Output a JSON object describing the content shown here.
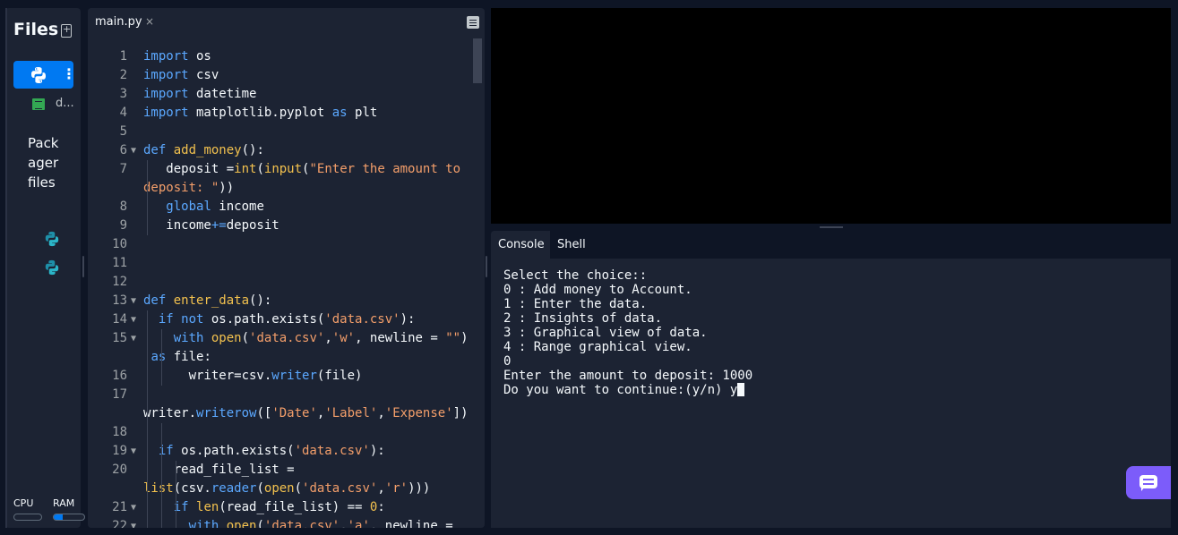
{
  "files_panel": {
    "title": "Files",
    "main_file_label": "main.py",
    "data_file_label": "d...",
    "packager_label": "Packager files",
    "cpu_label": "CPU",
    "ram_label": "RAM",
    "cpu_usage_fraction": 0.0,
    "ram_usage_fraction": 0.3
  },
  "editor": {
    "tab_label": "main.py",
    "tab_close": "×",
    "lines": [
      {
        "n": "1",
        "fold": "",
        "tokens": [
          [
            "kw",
            "import"
          ],
          [
            "",
            " os"
          ]
        ]
      },
      {
        "n": "2",
        "fold": "",
        "tokens": [
          [
            "kw",
            "import"
          ],
          [
            "",
            " csv"
          ]
        ]
      },
      {
        "n": "3",
        "fold": "",
        "tokens": [
          [
            "kw",
            "import"
          ],
          [
            "",
            " datetime"
          ]
        ]
      },
      {
        "n": "4",
        "fold": "",
        "tokens": [
          [
            "kw",
            "import"
          ],
          [
            "",
            " matplotlib.pyplot "
          ],
          [
            "kw",
            "as"
          ],
          [
            "",
            " plt"
          ]
        ]
      },
      {
        "n": "5",
        "fold": "",
        "tokens": []
      },
      {
        "n": "6",
        "fold": "▼",
        "tokens": [
          [
            "kw",
            "def"
          ],
          [
            "",
            " "
          ],
          [
            "fn",
            "add_money"
          ],
          [
            "",
            "():"
          ]
        ]
      },
      {
        "n": "7",
        "fold": "",
        "tokens": [
          [
            "",
            "   deposit ="
          ],
          [
            "fn",
            "int"
          ],
          [
            "",
            "("
          ],
          [
            "fn",
            "input"
          ],
          [
            "",
            "("
          ],
          [
            "str",
            "\"Enter the amount to"
          ]
        ]
      },
      {
        "n": "",
        "fold": "",
        "tokens": [
          [
            "str",
            "deposit: \""
          ],
          [
            "",
            "))"
          ]
        ]
      },
      {
        "n": "8",
        "fold": "",
        "tokens": [
          [
            "",
            "   "
          ],
          [
            "kw",
            "global"
          ],
          [
            "",
            " income"
          ]
        ]
      },
      {
        "n": "9",
        "fold": "",
        "tokens": [
          [
            "",
            "   income"
          ],
          [
            "kw",
            "+="
          ],
          [
            "",
            "deposit"
          ]
        ]
      },
      {
        "n": "10",
        "fold": "",
        "tokens": []
      },
      {
        "n": "11",
        "fold": "",
        "tokens": []
      },
      {
        "n": "12",
        "fold": "",
        "tokens": []
      },
      {
        "n": "13",
        "fold": "▼",
        "tokens": [
          [
            "kw",
            "def"
          ],
          [
            "",
            " "
          ],
          [
            "fn",
            "enter_data"
          ],
          [
            "",
            "():"
          ]
        ]
      },
      {
        "n": "14",
        "fold": "▼",
        "tokens": [
          [
            "",
            "  "
          ],
          [
            "kw",
            "if not"
          ],
          [
            "",
            " os.path.exists("
          ],
          [
            "str",
            "'data.csv'"
          ],
          [
            "",
            "):"
          ]
        ]
      },
      {
        "n": "15",
        "fold": "▼",
        "tokens": [
          [
            "",
            "    "
          ],
          [
            "kw",
            "with"
          ],
          [
            "",
            " "
          ],
          [
            "fn",
            "open"
          ],
          [
            "",
            "("
          ],
          [
            "str",
            "'data.csv'"
          ],
          [
            "",
            ","
          ],
          [
            "str",
            "'w'"
          ],
          [
            "",
            ", newline = "
          ],
          [
            "str",
            "\"\""
          ],
          [
            "",
            ")"
          ]
        ]
      },
      {
        "n": "",
        "fold": "",
        "tokens": [
          [
            "",
            " "
          ],
          [
            "kw",
            "as"
          ],
          [
            "",
            " file:"
          ]
        ]
      },
      {
        "n": "16",
        "fold": "",
        "tokens": [
          [
            "",
            "      writer=csv."
          ],
          [
            "kw",
            "writer"
          ],
          [
            "",
            "(file)"
          ]
        ]
      },
      {
        "n": "17",
        "fold": "",
        "tokens": []
      },
      {
        "n": "",
        "fold": "",
        "tokens": [
          [
            "",
            "writer."
          ],
          [
            "kw",
            "writerow"
          ],
          [
            "",
            "(["
          ],
          [
            "str",
            "'Date'"
          ],
          [
            "",
            ","
          ],
          [
            "str",
            "'Label'"
          ],
          [
            "",
            ","
          ],
          [
            "str",
            "'Expense'"
          ],
          [
            "",
            "])"
          ]
        ]
      },
      {
        "n": "18",
        "fold": "",
        "tokens": []
      },
      {
        "n": "19",
        "fold": "▼",
        "tokens": [
          [
            "",
            "  "
          ],
          [
            "kw",
            "if"
          ],
          [
            "",
            " os.path.exists("
          ],
          [
            "str",
            "'data.csv'"
          ],
          [
            "",
            "):"
          ]
        ]
      },
      {
        "n": "20",
        "fold": "",
        "tokens": [
          [
            "",
            "    read_file_list ="
          ]
        ]
      },
      {
        "n": "",
        "fold": "",
        "tokens": [
          [
            "fn",
            "list"
          ],
          [
            "",
            "(csv."
          ],
          [
            "kw",
            "reader"
          ],
          [
            "",
            "("
          ],
          [
            "fn",
            "open"
          ],
          [
            "",
            "("
          ],
          [
            "str",
            "'data.csv'"
          ],
          [
            "",
            ","
          ],
          [
            "str",
            "'r'"
          ],
          [
            "",
            ")))"
          ]
        ]
      },
      {
        "n": "21",
        "fold": "▼",
        "tokens": [
          [
            "",
            "    "
          ],
          [
            "kw",
            "if"
          ],
          [
            "",
            " "
          ],
          [
            "fn",
            "len"
          ],
          [
            "",
            "(read_file_list) == "
          ],
          [
            "fn",
            "0"
          ],
          [
            "",
            ":"
          ]
        ]
      },
      {
        "n": "22",
        "fold": "▼",
        "tokens": [
          [
            "",
            "      "
          ],
          [
            "kw",
            "with"
          ],
          [
            "",
            " "
          ],
          [
            "fn",
            "open"
          ],
          [
            "",
            "("
          ],
          [
            "str",
            "'data.csv'"
          ],
          [
            "",
            ","
          ],
          [
            "str",
            "'a'"
          ],
          [
            "",
            ", newline ="
          ]
        ]
      }
    ]
  },
  "console": {
    "tab_console": "Console",
    "tab_shell": "Shell",
    "output": "Select the choice::\n0 : Add money to Account.\n1 : Enter the data.\n2 : Insights of data.\n3 : Graphical view of data.\n4 : Range graphical view.\n0\nEnter the amount to deposit: 1000\nDo you want to continue:(y/n) y"
  },
  "icons": {
    "new_file": "new-file-icon",
    "python": "python-icon",
    "more": "more-vertical-icon",
    "spreadsheet": "spreadsheet-icon",
    "editor_options": "editor-options-icon",
    "chat": "chat-icon"
  },
  "colors": {
    "background": "#0e1525",
    "panel": "#1c2333",
    "accent": "#0079f2",
    "keyword": "#5ba8ff",
    "function": "#f2c14e",
    "string": "#f39e6a",
    "chat_button": "#7c5cfa"
  }
}
